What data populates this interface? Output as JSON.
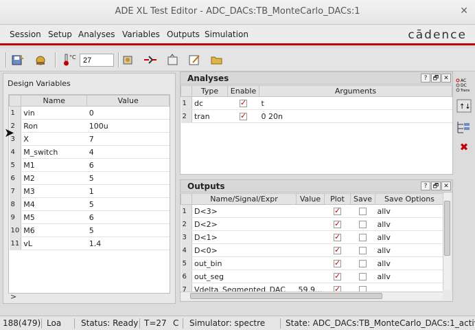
{
  "window": {
    "title": "ADE XL Test Editor - ADC_DACs:TB_MonteCarlo_DACs:1"
  },
  "menu": [
    "Session",
    "Setup",
    "Analyses",
    "Variables",
    "Outputs",
    "Simulation"
  ],
  "brand": "cādence",
  "toolbar": {
    "temperature": "27",
    "temp_label": "°C"
  },
  "design_variables": {
    "title": "Design Variables",
    "columns": [
      "Name",
      "Value"
    ],
    "rows": [
      {
        "n": "1",
        "name": "vin",
        "value": "0"
      },
      {
        "n": "2",
        "name": "Ron",
        "value": "100u"
      },
      {
        "n": "3",
        "name": "X",
        "value": "7"
      },
      {
        "n": "4",
        "name": "M_switch",
        "value": "4"
      },
      {
        "n": "5",
        "name": "M1",
        "value": "6"
      },
      {
        "n": "6",
        "name": "M2",
        "value": "5"
      },
      {
        "n": "7",
        "name": "M3",
        "value": "1"
      },
      {
        "n": "8",
        "name": "M4",
        "value": "5"
      },
      {
        "n": "9",
        "name": "M5",
        "value": "6"
      },
      {
        "n": "10",
        "name": "M6",
        "value": "5"
      },
      {
        "n": "11",
        "name": "vL",
        "value": "1.4"
      }
    ],
    "footer": ">"
  },
  "analyses": {
    "title": "Analyses",
    "columns": [
      "Type",
      "Enable",
      "Arguments"
    ],
    "rows": [
      {
        "n": "1",
        "type": "dc",
        "enable": true,
        "args": "t"
      },
      {
        "n": "2",
        "type": "tran",
        "enable": true,
        "args": "0 20n"
      }
    ]
  },
  "outputs": {
    "title": "Outputs",
    "columns": [
      "Name/Signal/Expr",
      "Value",
      "Plot",
      "Save",
      "Save Options"
    ],
    "rows": [
      {
        "n": "1",
        "name": "D<3>",
        "value": "",
        "plot": true,
        "save": false,
        "opt": "allv"
      },
      {
        "n": "2",
        "name": "D<2>",
        "value": "",
        "plot": true,
        "save": false,
        "opt": "allv"
      },
      {
        "n": "3",
        "name": "D<1>",
        "value": "",
        "plot": true,
        "save": false,
        "opt": "allv"
      },
      {
        "n": "4",
        "name": "D<0>",
        "value": "",
        "plot": true,
        "save": false,
        "opt": "allv"
      },
      {
        "n": "5",
        "name": "out_bin",
        "value": "",
        "plot": true,
        "save": false,
        "opt": "allv"
      },
      {
        "n": "6",
        "name": "out_seg",
        "value": "",
        "plot": true,
        "save": false,
        "opt": "allv"
      },
      {
        "n": "7",
        "name": "Vdelta_Segmented_DAC",
        "value": "59.9...",
        "plot": true,
        "save": false,
        "opt": ""
      }
    ]
  },
  "dock_buttons": [
    "?",
    "🗗",
    "✕"
  ],
  "right_icons": {
    "ac_dc_trans": "AC DC Trans"
  },
  "status": {
    "mem": "188(479)",
    "load": "Loa",
    "state": "Status: Ready",
    "temp": "T=27",
    "unit": "C",
    "sim": "Simulator: spectre",
    "cellstate": "State: ADC_DACs:TB_MonteCarlo_DACs:1_active"
  },
  "colors": {
    "accent": "#c00000",
    "check": "#c00000"
  }
}
